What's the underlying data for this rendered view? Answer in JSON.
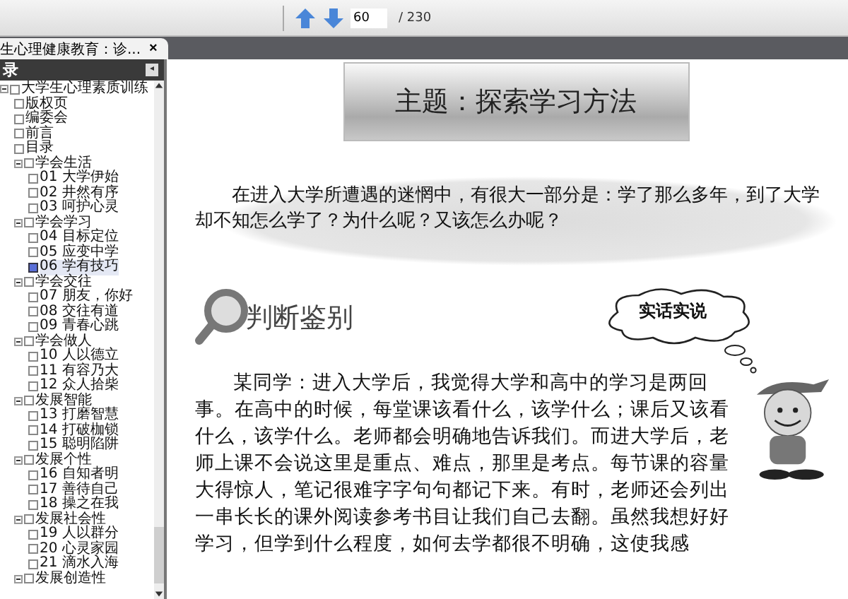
{
  "toolbar": {
    "page_input": "60",
    "page_total": "/ 230"
  },
  "tab": {
    "title": "生心理健康教育：诊...",
    "close": "×"
  },
  "sidebar": {
    "title": "录",
    "collapse": "◂",
    "tree": [
      {
        "label": "大学生心理素质训练",
        "selected": false,
        "expanded": true,
        "children": [
          {
            "label": "版权页",
            "selected": false
          },
          {
            "label": "编委会",
            "selected": false
          },
          {
            "label": "前言",
            "selected": false
          },
          {
            "label": "目录",
            "selected": false
          },
          {
            "label": "学会生活",
            "selected": false,
            "expanded": true,
            "children": [
              {
                "label": "01 大学伊始",
                "selected": false
              },
              {
                "label": "02 井然有序",
                "selected": false
              },
              {
                "label": "03 呵护心灵",
                "selected": false
              }
            ]
          },
          {
            "label": "学会学习",
            "selected": false,
            "expanded": true,
            "children": [
              {
                "label": "04 目标定位",
                "selected": false
              },
              {
                "label": "05 应变中学",
                "selected": false
              },
              {
                "label": "06 学有技巧",
                "selected": true
              }
            ]
          },
          {
            "label": "学会交往",
            "selected": false,
            "expanded": true,
            "children": [
              {
                "label": "07 朋友，你好",
                "selected": false
              },
              {
                "label": "08 交往有道",
                "selected": false
              },
              {
                "label": "09 青春心跳",
                "selected": false
              }
            ]
          },
          {
            "label": "学会做人",
            "selected": false,
            "expanded": true,
            "children": [
              {
                "label": "10 人以德立",
                "selected": false
              },
              {
                "label": "11 有容乃大",
                "selected": false
              },
              {
                "label": "12 众人拾柴",
                "selected": false
              }
            ]
          },
          {
            "label": "发展智能",
            "selected": false,
            "expanded": true,
            "children": [
              {
                "label": "13 打磨智慧",
                "selected": false
              },
              {
                "label": "14 打破枷锁",
                "selected": false
              },
              {
                "label": "15 聪明陷阱",
                "selected": false
              }
            ]
          },
          {
            "label": "发展个性",
            "selected": false,
            "expanded": true,
            "children": [
              {
                "label": "16 自知者明",
                "selected": false
              },
              {
                "label": "17 善待自己",
                "selected": false
              },
              {
                "label": "18 操之在我",
                "selected": false
              }
            ]
          },
          {
            "label": "发展社会性",
            "selected": false,
            "expanded": true,
            "children": [
              {
                "label": "19 人以群分",
                "selected": false
              },
              {
                "label": "20 心灵家园",
                "selected": false
              },
              {
                "label": "21 滴水入海",
                "selected": false
              }
            ]
          },
          {
            "label": "发展创造性",
            "selected": false,
            "expanded": true
          }
        ]
      }
    ]
  },
  "page": {
    "banner_title": "主题：探索学习方法",
    "intro": "在进入大学所遭遇的迷惘中，有很大一部分是：学了那么多年，到了大学却不知怎么学了？为什么呢？又该怎么办呢？",
    "section_heading": "判断鉴别",
    "bubble": "实话实说",
    "body": "某同学：进入大学后，我觉得大学和高中的学习是两回事。在高中的时候，每堂课该看什么，该学什么；课后又该看什么，该学什么。老师都会明确地告诉我们。而进大学后，老师上课不会说这里是重点、难点，那里是考点。每节课的容量大得惊人，笔记很难字字句句都记下来。有时，老师还会列出一串长长的课外阅读参考书目让我们自己去翻。虽然我想好好学习，但学到什么程度，如何去学都很不明确，这使我感"
  }
}
